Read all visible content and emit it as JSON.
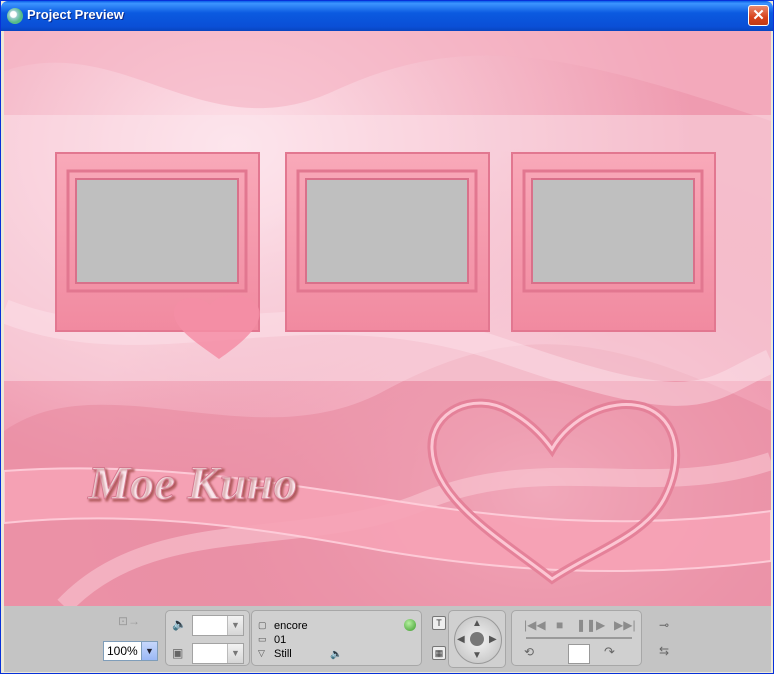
{
  "window": {
    "title": "Project Preview",
    "close_glyph": "✕"
  },
  "menu": {
    "title_text": "Мое Кино",
    "thumbnail_count": 3
  },
  "controls": {
    "zoom_value": "100%",
    "info": {
      "line1": "encore",
      "line2": "01",
      "line3": "Still"
    },
    "icons": {
      "audio_stream": "speaker-icon",
      "subtitle_stream": "subtitle-icon",
      "status": "green-status-icon",
      "remote": "dvd-remote-dpad-icon"
    }
  },
  "colors": {
    "titlebar": "#0a4fd6",
    "close": "#d7421b",
    "preview_pink": "#f0a7b8",
    "frame_pink": "#f79aac",
    "panel": "#c4c4c4"
  }
}
